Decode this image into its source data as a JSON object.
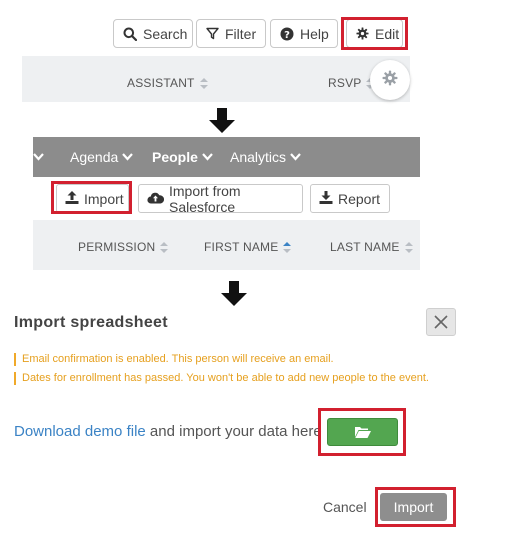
{
  "toolbar": {
    "search_label": "Search",
    "filter_label": "Filter",
    "help_label": "Help",
    "edit_label": "Edit"
  },
  "table1": {
    "col_assistant": "ASSISTANT",
    "col_rsvp": "RSVP"
  },
  "nav": {
    "items": [
      "Agenda",
      "People",
      "Analytics"
    ],
    "active": "People"
  },
  "people_actions": {
    "import_label": "Import",
    "import_salesforce_label": "Import from Salesforce",
    "report_label": "Report"
  },
  "table2": {
    "col_permission": "PERMISSION",
    "col_first_name": "FIRST NAME",
    "col_last_name": "LAST NAME"
  },
  "modal": {
    "title": "Import spreadsheet",
    "warnings": [
      "Email confirmation is enabled. This person will receive an email.",
      "Dates for enrollment has passed. You won't be able to add new people to the event."
    ],
    "download_link": "Download demo file",
    "download_text": " and import your data here",
    "cancel_label": "Cancel",
    "import_label": "Import"
  },
  "colors": {
    "highlight": "#d2202f",
    "nav_bg": "#8c8c8c",
    "link": "#3b83c5",
    "warning": "#e6a01f",
    "green": "#53a650",
    "import_btn": "#8e8e8e"
  },
  "icons": [
    "search-icon",
    "filter-icon",
    "help-icon",
    "gear-icon",
    "down-arrow-icon",
    "upload-icon",
    "cloud-upload-icon",
    "download-icon",
    "close-icon",
    "folder-open-icon",
    "chevron-down-icon"
  ]
}
